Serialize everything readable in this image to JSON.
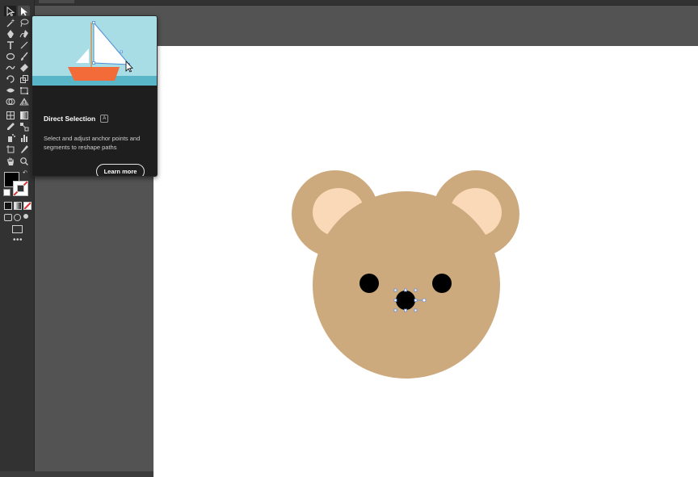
{
  "tooltip": {
    "title": "Direct Selection",
    "shortcut": "A",
    "description": "Select and adjust anchor points and segments to reshape paths",
    "learn_more_label": "Learn more"
  },
  "tools": [
    "selection-tool",
    "direct-selection-tool",
    "magic-wand-tool",
    "lasso-tool",
    "pen-tool",
    "curvature-tool",
    "type-tool",
    "line-segment-tool",
    "ellipse-tool",
    "paintbrush-tool",
    "shaper-tool",
    "eraser-tool",
    "rotate-tool",
    "scale-tool",
    "width-tool",
    "free-transform-tool",
    "shape-builder-tool",
    "perspective-grid-tool",
    "mesh-tool",
    "gradient-tool",
    "eyedropper-tool",
    "blend-tool",
    "symbol-sprayer-tool",
    "column-graph-tool",
    "artboard-tool",
    "slice-tool",
    "hand-tool",
    "zoom-tool"
  ],
  "colors": {
    "fill": "#000000",
    "stroke": "none",
    "bear_fur": "#CDAA7D",
    "bear_inner_ear": "#FAD9B8",
    "bear_features": "#000000",
    "boat_hull": "#F26B38",
    "sky": "#A8DDE6"
  }
}
